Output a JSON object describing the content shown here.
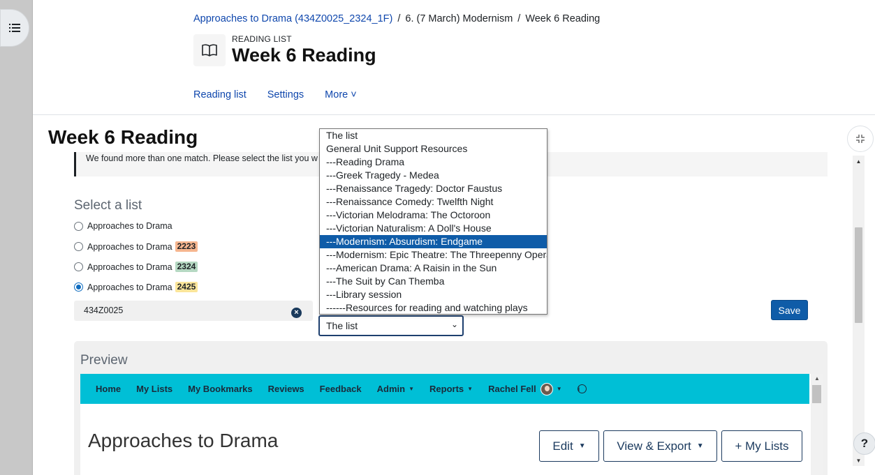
{
  "breadcrumb": {
    "course": "Approaches to Drama (434Z0025_2324_1F)",
    "section": "6. (7 March) Modernism",
    "current": "Week 6 Reading",
    "separator": "/"
  },
  "header": {
    "kicker": "READING LIST",
    "title": "Week 6 Reading",
    "icon": "book-open-icon"
  },
  "secondary_nav": {
    "items": [
      "Reading list",
      "Settings",
      "More ˅"
    ]
  },
  "main": {
    "heading": "Week 6 Reading",
    "alert": "We found more than one match. Please select the list you w",
    "select_label": "Select a list",
    "radios": [
      {
        "label": "Approaches to Drama",
        "badge": "",
        "checked": false
      },
      {
        "label": "Approaches to Drama",
        "badge": "2223",
        "badge_color": "#f6b68f",
        "checked": false
      },
      {
        "label": "Approaches to Drama",
        "badge": "2324",
        "badge_color": "#b5d8c2",
        "checked": false
      },
      {
        "label": "Approaches to Drama",
        "badge": "2425",
        "badge_color": "#fbe59a",
        "checked": true
      }
    ],
    "code_value": "434Z0025",
    "list_select_value": "The list",
    "save_label": "Save"
  },
  "dropdown": {
    "options": [
      "The list",
      "General Unit Support Resources",
      "---Reading Drama",
      "---Greek Tragedy - Medea",
      "---Renaissance Tragedy: Doctor Faustus",
      "---Renaissance Comedy: Twelfth Night",
      "---Victorian Melodrama: The Octoroon",
      "---Victorian Naturalism: A Doll's House",
      "---Modernism: Absurdism: Endgame",
      "---Modernism: Epic Theatre: The Threepenny Opera",
      "---American Drama: A Raisin in the Sun",
      "---The Suit by Can Themba",
      "---Library session",
      "------Resources for reading and watching plays"
    ],
    "highlighted_index": 8
  },
  "preview": {
    "label": "Preview",
    "nav": {
      "home": "Home",
      "my_lists": "My Lists",
      "my_bookmarks": "My Bookmarks",
      "reviews": "Reviews",
      "feedback": "Feedback",
      "admin": "Admin",
      "reports": "Reports",
      "user": "Rachel Fell"
    },
    "title": "Approaches to Drama",
    "buttons": {
      "edit": "Edit",
      "view_export": "View & Export",
      "my_lists": "+ My Lists"
    }
  },
  "help_label": "?",
  "colors": {
    "link": "#0f47ad",
    "primary": "#0f5ca8",
    "talis_nav": "#00bfd6"
  }
}
